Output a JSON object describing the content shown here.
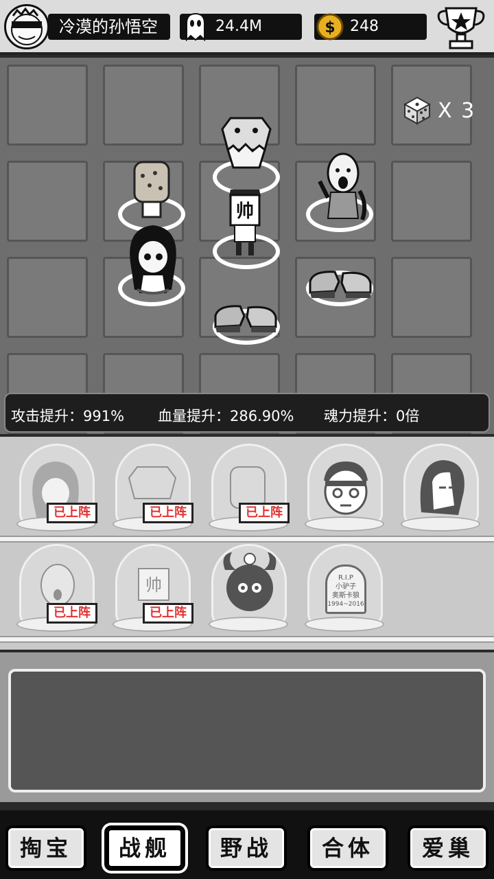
{
  "player": {
    "name": "冷漠的孙悟空",
    "souls": "24.4M",
    "coins": "248"
  },
  "board": {
    "dice_count": "X 3"
  },
  "buffs": [
    {
      "label": "攻击提升：991%"
    },
    {
      "label": "血量提升：286.90%"
    },
    {
      "label": "魂力提升：0倍"
    }
  ],
  "collection": {
    "deployed_tag": "已上阵",
    "tombstone": {
      "line1": "R.I.P",
      "line2": "小驴子",
      "line3": "奥斯卡狼",
      "line4": "1994~2016"
    }
  },
  "nav": {
    "items": [
      "掏宝",
      "战舰",
      "野战",
      "合体",
      "爱巢"
    ],
    "active": "战舰"
  },
  "icons": {
    "avatar": "avatar-icon",
    "ghost": "ghost-icon",
    "coin": "coin-icon",
    "trophy": "trophy-icon",
    "dice": "dice-icon"
  }
}
